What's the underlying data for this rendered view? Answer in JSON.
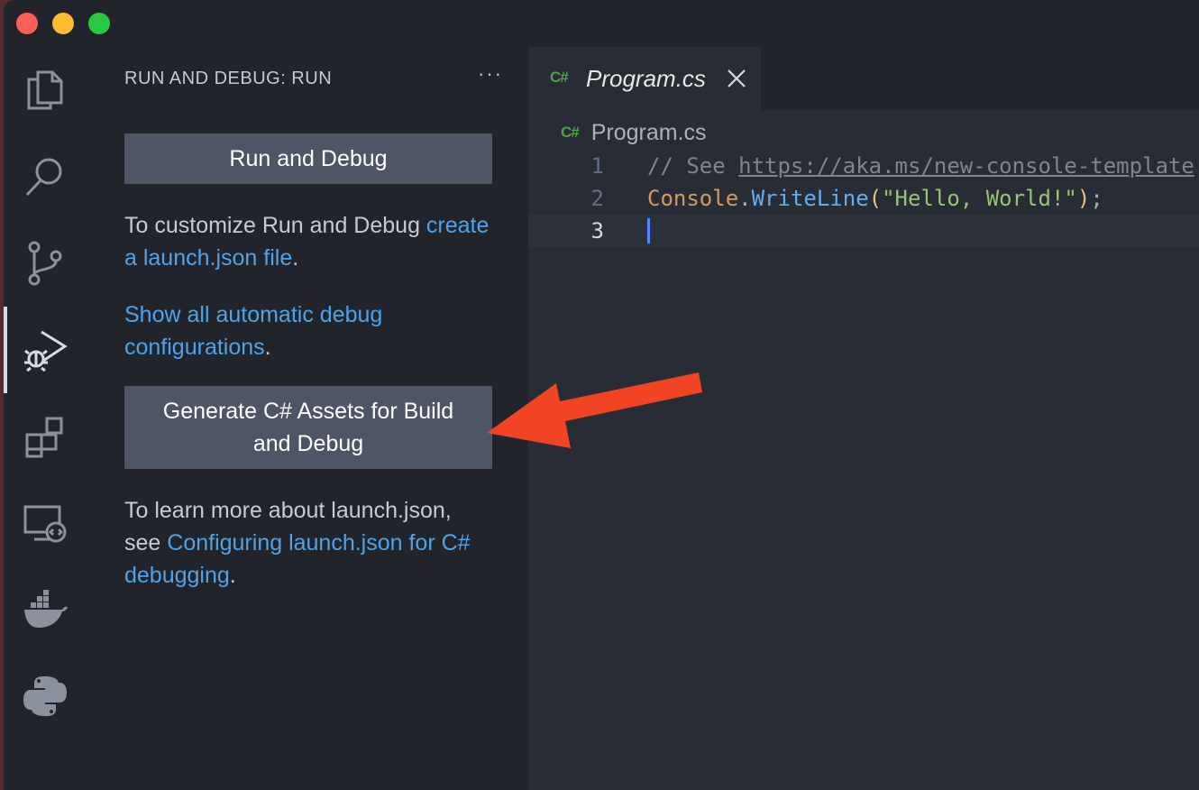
{
  "window": {
    "traffic_lights": [
      "close",
      "minimize",
      "maximize"
    ]
  },
  "activity_bar": {
    "items": [
      {
        "icon": "files-icon"
      },
      {
        "icon": "search-icon"
      },
      {
        "icon": "source-control-icon"
      },
      {
        "icon": "run-debug-icon",
        "active": true
      },
      {
        "icon": "extensions-icon"
      },
      {
        "icon": "remote-explorer-icon"
      },
      {
        "icon": "docker-icon"
      },
      {
        "icon": "python-icon"
      }
    ]
  },
  "sidebar": {
    "title": "RUN AND DEBUG: RUN",
    "more_label": "···",
    "run_button": "Run and Debug",
    "customize_text": "To customize Run and Debug ",
    "customize_link": "create a launch.json file",
    "customize_suffix": ".",
    "show_link": "Show all automatic debug configurations",
    "show_suffix": ".",
    "generate_button": "Generate C# Assets for Build and Debug",
    "learn_text": "To learn more about launch.json, see ",
    "learn_link": "Configuring launch.json for C# debugging",
    "learn_suffix": "."
  },
  "editor": {
    "tab_icon": "C#",
    "tab_label": "Program.cs",
    "breadcrumb_icon": "C#",
    "breadcrumb_label": "Program.cs",
    "lines": [
      {
        "number": "1",
        "comment_prefix": "// See ",
        "url": "https://aka.ms/new-console-template"
      },
      {
        "number": "2",
        "class": "Console",
        "dot": ".",
        "method": "WriteLine",
        "open": "(",
        "string": "\"Hello, World!\"",
        "close": ")",
        "semi": ";"
      },
      {
        "number": "3"
      }
    ]
  },
  "colors": {
    "accent_link": "#4fa3e8",
    "button_bg": "#4d5566",
    "annotation_arrow": "#f04423",
    "csharp_icon": "#4fa34a"
  }
}
